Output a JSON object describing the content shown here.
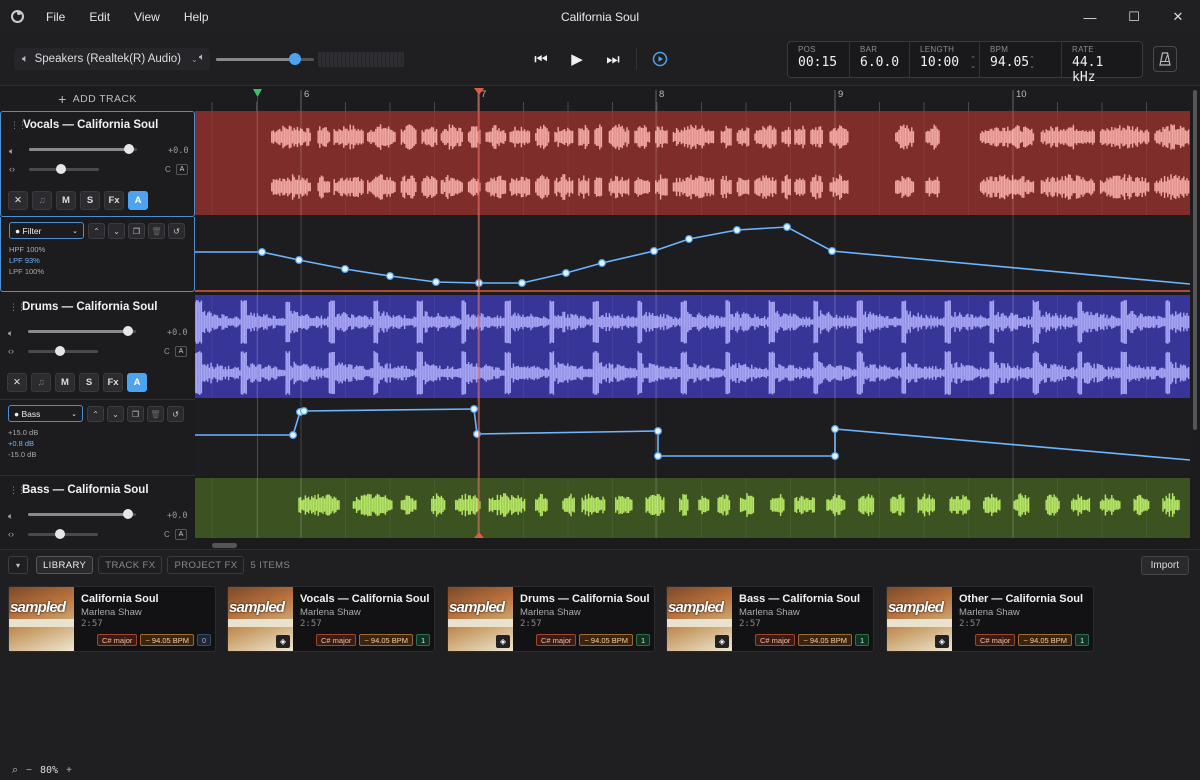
{
  "window": {
    "title": "California Soul",
    "menu": [
      "File",
      "Edit",
      "View",
      "Help"
    ],
    "controls": [
      "—",
      "☐",
      "✕"
    ]
  },
  "toolbar": {
    "device": "Speakers (Realtek(R) Audio)",
    "master_volume": 0.81,
    "info": {
      "pos_label": "POS",
      "pos": "00:15",
      "bar_label": "BAR",
      "bar": "6.0.0",
      "length_label": "LENGTH",
      "length": "10:00",
      "bpm_label": "BPM",
      "bpm": "94.05",
      "rate_label": "RATE",
      "rate": "44.1 kHz"
    }
  },
  "tracks_panel": {
    "add_track": "ADD TRACK",
    "tracks": [
      {
        "name": "Vocals — California Soul",
        "volume": 0.93,
        "pan": 0.45,
        "vol_db": "+0.0",
        "pan_label": "C",
        "auto_badge": "A",
        "color": "#b84b46"
      },
      {
        "name": "Drums — California Soul",
        "volume": 0.93,
        "pan": 0.45,
        "vol_db": "+0.0",
        "pan_label": "C",
        "auto_badge": "A",
        "color": "#4a47b2"
      },
      {
        "name": "Bass — California Soul",
        "volume": 0.93,
        "pan": 0.45,
        "vol_db": "+0.0",
        "pan_label": "C",
        "auto_badge": "A",
        "color": "#5b7a2a"
      }
    ],
    "track_buttons": [
      "M",
      "S",
      "Fx",
      "A"
    ],
    "automation": [
      {
        "param": "Filter",
        "lines": [
          "HPF 100%",
          "LPF 93%",
          "LPF 100%"
        ]
      },
      {
        "param": "Bass",
        "lines": [
          "+15.0 dB",
          "+0.8 dB",
          "-15.0 dB"
        ]
      }
    ]
  },
  "timeline": {
    "bar_labels": [
      "6",
      "7",
      "8",
      "9",
      "10"
    ]
  },
  "library": {
    "tabs": [
      "LIBRARY",
      "TRACK FX",
      "PROJECT FX"
    ],
    "count": "5 ITEMS",
    "import": "Import",
    "cover_word": "sampled",
    "items": [
      {
        "title": "California Soul",
        "artist": "Marlena Shaw",
        "duration": "2:57",
        "key": "C# major",
        "bpm": "~ 94.05 BPM",
        "count": "0"
      },
      {
        "title": "Vocals — California Soul",
        "artist": "Marlena Shaw",
        "duration": "2:57",
        "key": "C# major",
        "bpm": "~ 94.05 BPM",
        "count": "1"
      },
      {
        "title": "Drums — California Soul",
        "artist": "Marlena Shaw",
        "duration": "2:57",
        "key": "C# major",
        "bpm": "~ 94.05 BPM",
        "count": "1"
      },
      {
        "title": "Bass — California Soul",
        "artist": "Marlena Shaw",
        "duration": "2:57",
        "key": "C# major",
        "bpm": "~ 94.05 BPM",
        "count": "1"
      },
      {
        "title": "Other — California Soul",
        "artist": "Marlena Shaw",
        "duration": "2:57",
        "key": "C# major",
        "bpm": "~ 94.05 BPM",
        "count": "1"
      }
    ]
  },
  "status": {
    "zoom": "80%",
    "minus": "−",
    "plus": "+"
  },
  "colors": {
    "accent": "#4da3f0",
    "playhead": "#e05a4a",
    "loop_marker": "#3fbf6a",
    "vocals_wave": "#f2a8a4",
    "drums_wave": "#a8a6f5",
    "bass_wave": "#b6e866"
  }
}
